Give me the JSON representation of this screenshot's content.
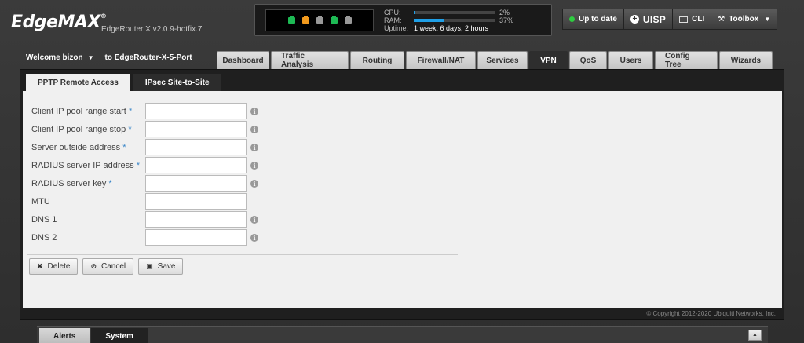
{
  "header": {
    "logo_text": "EdgeMAX",
    "logo_mark": "®",
    "version": "EdgeRouter X v2.0.9-hotfix.7",
    "ports": [
      {
        "name": "eth0",
        "status": "green"
      },
      {
        "name": "eth1",
        "status": "orange"
      },
      {
        "name": "eth2",
        "status": "grey"
      },
      {
        "name": "eth3",
        "status": "green"
      },
      {
        "name": "eth4",
        "status": "grey"
      }
    ],
    "cpu_label": "CPU:",
    "cpu_value": "2%",
    "cpu_fraction": 0.02,
    "ram_label": "RAM:",
    "ram_value": "37%",
    "ram_fraction": 0.37,
    "uptime_label": "Uptime:",
    "uptime_value": "1 week, 6 days, 2 hours",
    "buttons": {
      "update_label": "Up to date",
      "uisp_label": "UISP",
      "cli_label": "CLI",
      "toolbox_label": "Toolbox"
    }
  },
  "nav": {
    "welcome": "Welcome bizon",
    "router_name": "to EdgeRouter-X-5-Port",
    "tabs": [
      {
        "label": "Dashboard",
        "active": false
      },
      {
        "label": "Traffic Analysis",
        "active": false
      },
      {
        "label": "Routing",
        "active": false
      },
      {
        "label": "Firewall/NAT",
        "active": false
      },
      {
        "label": "Services",
        "active": false
      },
      {
        "label": "VPN",
        "active": true
      },
      {
        "label": "QoS",
        "active": false
      },
      {
        "label": "Users",
        "active": false
      },
      {
        "label": "Config Tree",
        "active": false
      },
      {
        "label": "Wizards",
        "active": false
      }
    ]
  },
  "main": {
    "subtabs": [
      {
        "label": "PPTP Remote Access",
        "active": true
      },
      {
        "label": "IPsec Site-to-Site",
        "active": false
      }
    ],
    "fields": [
      {
        "label": "Client IP pool range start",
        "required": "*",
        "value": "",
        "info": "i"
      },
      {
        "label": "Client IP pool range stop",
        "required": "*",
        "value": "",
        "info": "i"
      },
      {
        "label": "Server outside address",
        "required": "*",
        "value": "",
        "info": "i"
      },
      {
        "label": "RADIUS server IP address",
        "required": "*",
        "value": "",
        "info": "i"
      },
      {
        "label": "RADIUS server key",
        "required": "*",
        "value": "",
        "info": "i"
      },
      {
        "label": "MTU",
        "required": "",
        "value": "",
        "info": ""
      },
      {
        "label": "DNS 1",
        "required": "",
        "value": "",
        "info": "i"
      },
      {
        "label": "DNS 2",
        "required": "",
        "value": "",
        "info": "i"
      }
    ],
    "actions": {
      "delete_label": "Delete",
      "cancel_label": "Cancel",
      "save_label": "Save"
    },
    "copyright": "© Copyright 2012-2020 Ubiquiti Networks, Inc."
  },
  "bottom": {
    "tabs": [
      {
        "label": "Alerts"
      },
      {
        "label": "System"
      }
    ]
  },
  "colors": {
    "accent_blue": "#1f9fe6",
    "port_green": "#1db954",
    "port_orange": "#f29a1d",
    "status_green": "#2ecc40"
  }
}
